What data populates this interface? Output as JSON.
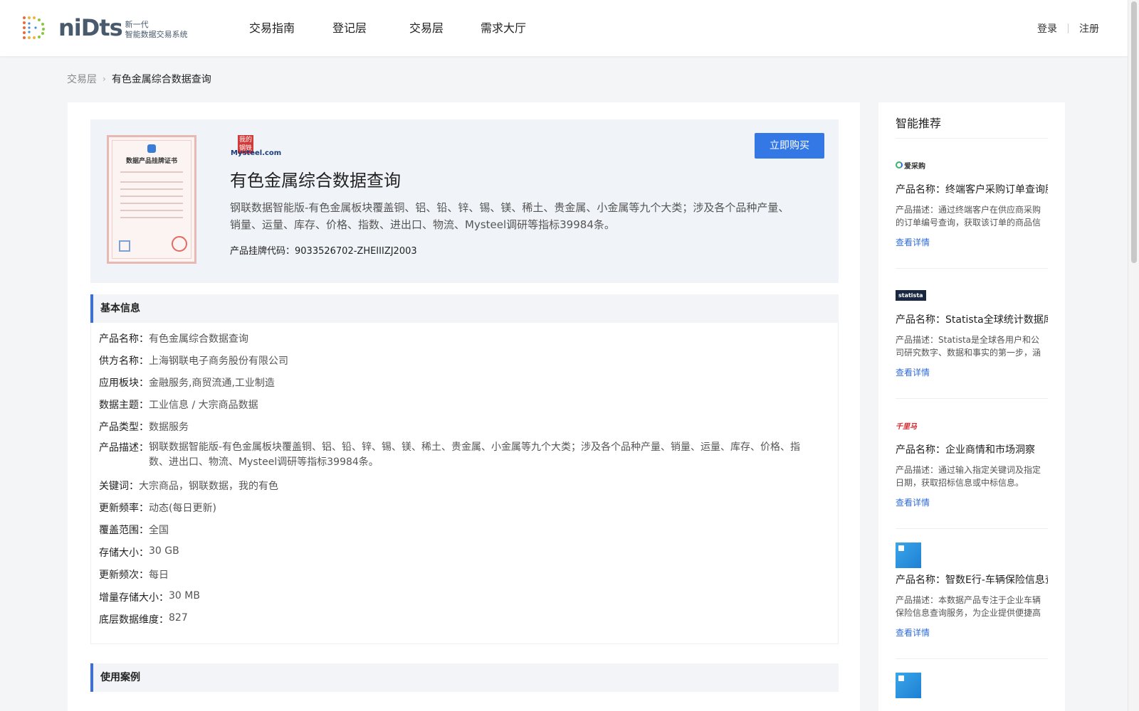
{
  "header": {
    "logo_word": "niDts",
    "logo_sub_line1": "新一代",
    "logo_sub_line2": "智能数据交易系统",
    "nav": [
      "交易指南",
      "登记层",
      "交易层",
      "需求大厅"
    ],
    "login": "登录",
    "register": "注册"
  },
  "breadcrumb": {
    "root": "交易层",
    "current": "有色金属综合数据查询"
  },
  "hero": {
    "brand_top": "我的",
    "brand_mid": "钢铁",
    "brand_word": "Mysteel.com",
    "cert_title": "数据产品挂牌证书",
    "title": "有色金属综合数据查询",
    "description": "钢联数据智能版-有色金属板块覆盖铜、铝、铅、锌、锡、镁、稀土、贵金属、小金属等九个大类；涉及各个品种产量、销量、运量、库存、价格、指数、进出口、物流、Mysteel调研等指标39984条。",
    "code_label": "产品挂牌代码：",
    "code_value": "9033526702-ZHEIIIZJ2003",
    "buy_label": "立即购买"
  },
  "basic_info": {
    "title": "基本信息",
    "rows": [
      {
        "k": "产品名称：",
        "v": "有色金属综合数据查询"
      },
      {
        "k": "供方名称：",
        "v": "上海钢联电子商务股份有限公司"
      },
      {
        "k": "应用板块：",
        "v": "金融服务,商贸流通,工业制造"
      },
      {
        "k": "数据主题：",
        "v": "工业信息 / 大宗商品数据"
      },
      {
        "k": "产品类型：",
        "v": "数据服务"
      },
      {
        "k": "产品描述：",
        "v": "钢联数据智能版-有色金属板块覆盖铜、铝、铅、锌、锡、镁、稀土、贵金属、小金属等九个大类；涉及各个品种产量、销量、运量、库存、价格、指数、进出口、物流、Mysteel调研等指标39984条。"
      },
      {
        "k": "关键词：",
        "v": "大宗商品，钢联数据，我的有色"
      },
      {
        "k": "更新频率：",
        "v": "动态(每日更新)"
      },
      {
        "k": "覆盖范围：",
        "v": "全国"
      },
      {
        "k": "存储大小：",
        "v": "30 GB"
      },
      {
        "k": "更新频次：",
        "v": "每日"
      },
      {
        "k": "增量存储大小：",
        "v": "30 MB"
      },
      {
        "k": "底层数据维度：",
        "v": "827"
      }
    ]
  },
  "use_cases": {
    "title": "使用案例"
  },
  "sidebar": {
    "title": "智能推荐",
    "items": [
      {
        "logo_text": "爱采购",
        "name": "产品名称：终端客户采购订单查询服务",
        "desc": "产品描述：通过终端客户在供应商采购的订单编号查询，获取该订单的商品信息及物流信息。",
        "link": "查看详情"
      },
      {
        "logo_text": "statista",
        "name": "产品名称：Statista全球统计数据库",
        "desc": "产品描述：Statista是全球各用户和公司研究数字、数据和事实的第一步，涵盖众多行业。",
        "link": "查看详情"
      },
      {
        "logo_text": "千里马",
        "name": "产品名称：企业商情和市场洞察",
        "desc": "产品描述：通过输入指定关键词及指定日期，获取招标信息或中标信息。",
        "link": "查看详情"
      },
      {
        "logo_text": "",
        "name": "产品名称：智数E行-车辆保险信息查询",
        "desc": "产品描述：本数据产品专注于企业车辆保险信息查询服务，为企业提供便捷高效的查询体验。",
        "link": "查看详情"
      }
    ]
  },
  "colors": {
    "accent": "#3478e5",
    "link": "#2f6bd8",
    "section_bar": "#3a6fe0"
  }
}
